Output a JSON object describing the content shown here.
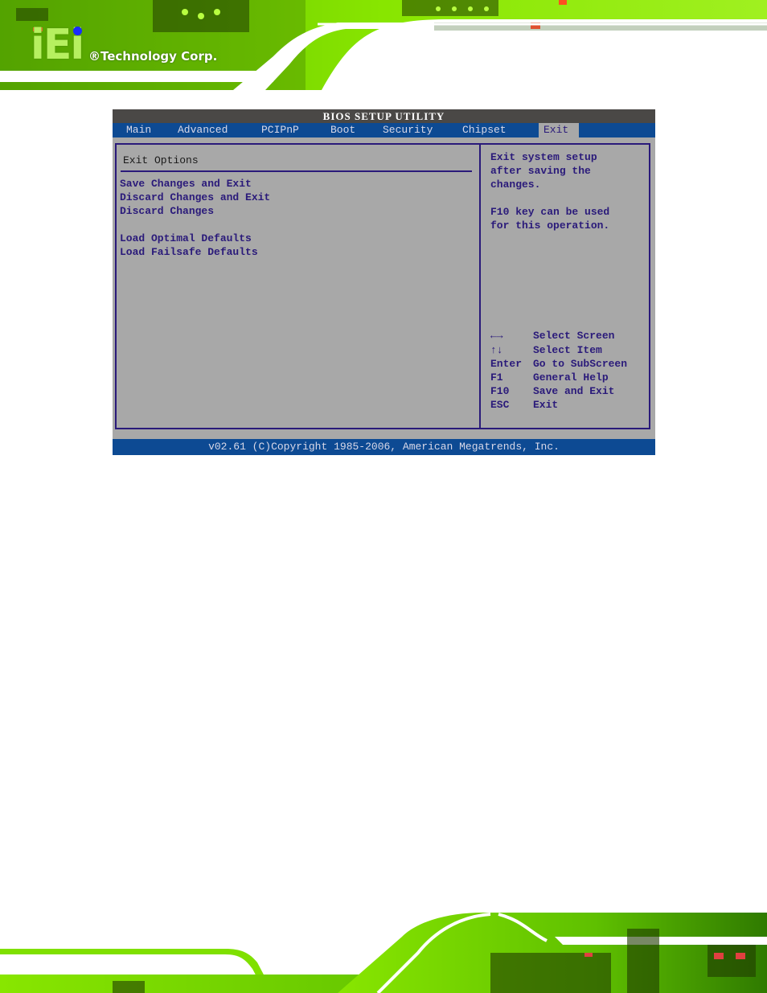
{
  "branding": {
    "logo_mark": "iEi",
    "logo_text": "®Technology Corp."
  },
  "bios": {
    "title": "BIOS SETUP UTILITY",
    "tabs": [
      {
        "label": "Main",
        "active": false
      },
      {
        "label": "Advanced",
        "active": false
      },
      {
        "label": "PCIPnP",
        "active": false
      },
      {
        "label": "Boot",
        "active": false
      },
      {
        "label": "Security",
        "active": false
      },
      {
        "label": "Chipset",
        "active": false
      },
      {
        "label": "Exit",
        "active": true
      }
    ],
    "section_title": "Exit Options",
    "options": [
      "Save Changes and Exit",
      "Discard Changes and Exit",
      "Discard Changes",
      "Load Optimal Defaults",
      "Load Failsafe Defaults"
    ],
    "help_text": [
      "Exit system setup",
      "after saving the",
      "changes.",
      "F10 key can be used",
      "for this operation."
    ],
    "key_legend": [
      {
        "key": "←→",
        "description": "Select Screen"
      },
      {
        "key": "↑↓",
        "description": "Select Item"
      },
      {
        "key": "Enter",
        "description": "Go to SubScreen"
      },
      {
        "key": "F1",
        "description": "General Help"
      },
      {
        "key": "F10",
        "description": "Save and Exit"
      },
      {
        "key": "ESC",
        "description": "Exit"
      }
    ],
    "footer": "v02.61 (C)Copyright 1985-2006, American Megatrends, Inc."
  },
  "colors": {
    "bios_background": "#a8a8a8",
    "menubar": "#0d4a93",
    "title_bar": "#4a4846",
    "text_accent": "#2a1a7a",
    "banner_green": "#7fe000"
  }
}
